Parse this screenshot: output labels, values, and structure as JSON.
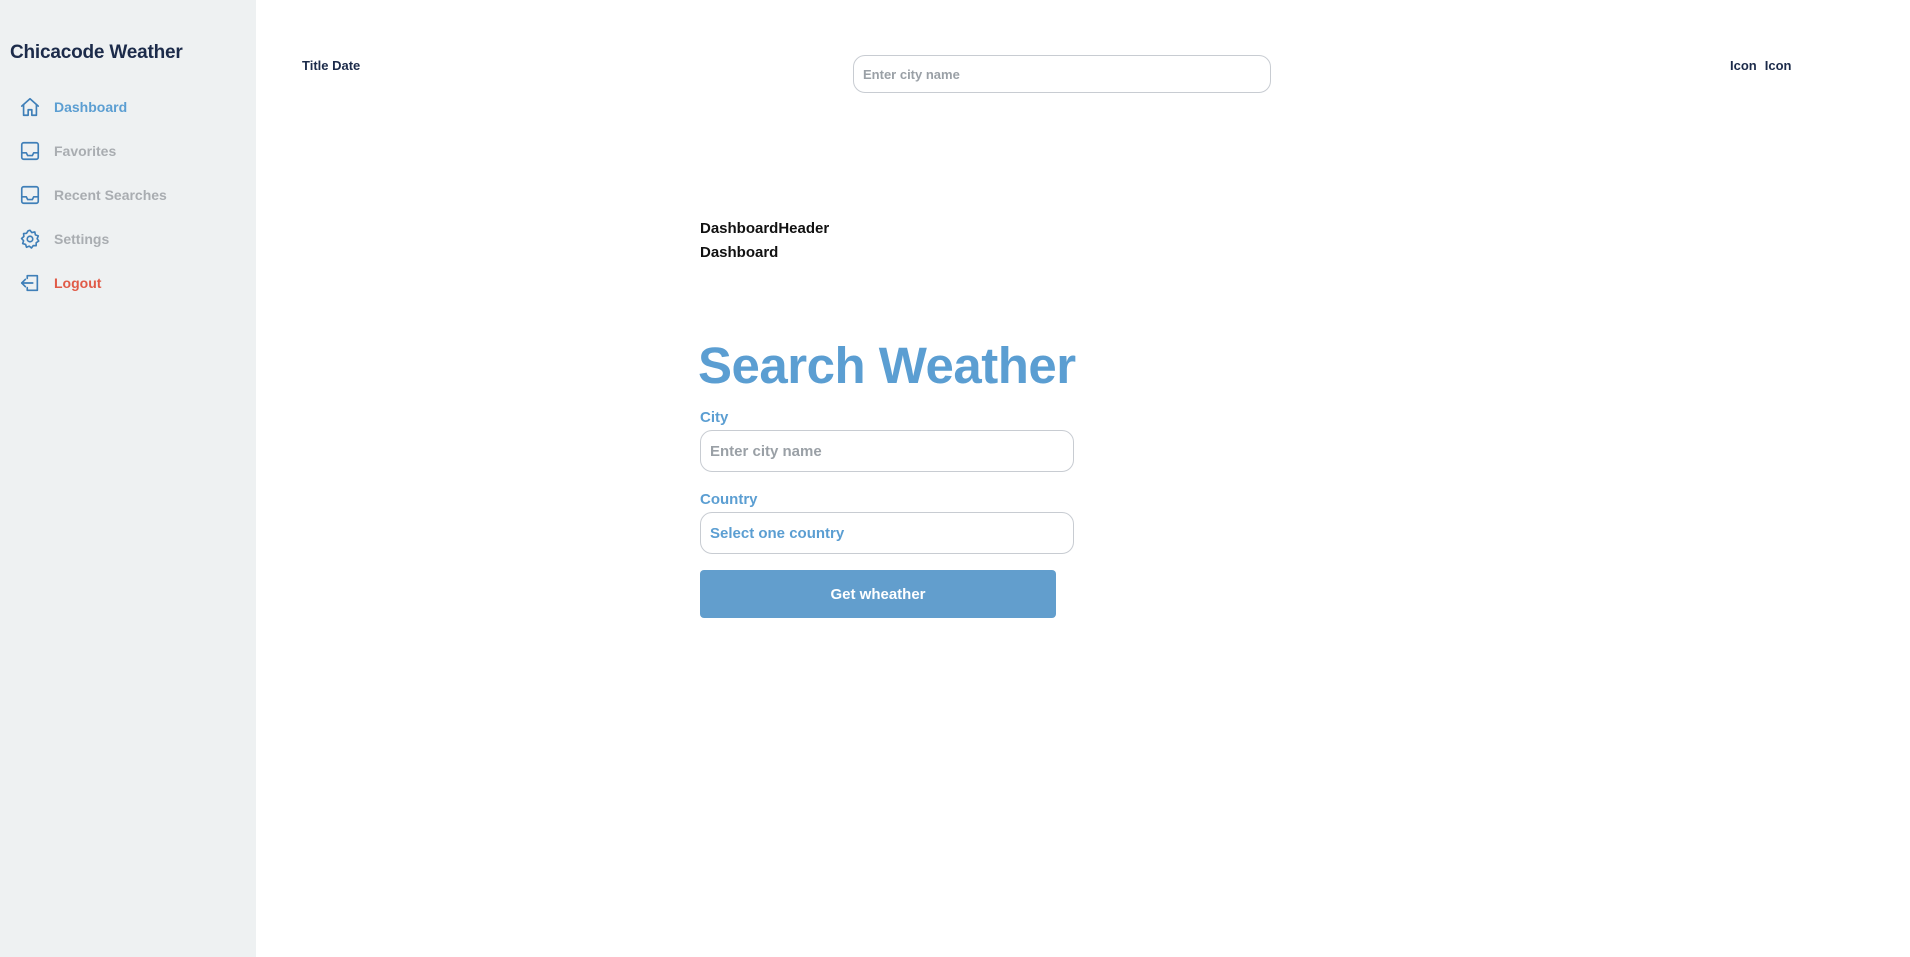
{
  "app": {
    "brand": "Chicacode Weather"
  },
  "colors": {
    "accent": "#5b9ed2",
    "button": "#629ecd",
    "danger": "#e05a47",
    "muted": "#a9adb1",
    "sidebar_bg": "#eef1f2",
    "brand_text": "#1c2b4a"
  },
  "sidebar": {
    "items": [
      {
        "label": "Dashboard",
        "icon": "home-icon",
        "state": "active"
      },
      {
        "label": "Favorites",
        "icon": "inbox-icon",
        "state": "muted"
      },
      {
        "label": "Recent Searches",
        "icon": "inbox-icon",
        "state": "muted"
      },
      {
        "label": "Settings",
        "icon": "gear-icon",
        "state": "muted"
      },
      {
        "label": "Logout",
        "icon": "logout-icon",
        "state": "danger"
      }
    ]
  },
  "topbar": {
    "title_date": "Title Date",
    "search_placeholder": "Enter city name",
    "icons": [
      "Icon",
      "Icon"
    ]
  },
  "main": {
    "header_line1": "DashboardHeader",
    "header_line2": "Dashboard",
    "title": "Search Weather",
    "city_label": "City",
    "city_placeholder": "Enter city name",
    "country_label": "Country",
    "country_value": "Select one country",
    "submit_label": "Get wheather"
  }
}
